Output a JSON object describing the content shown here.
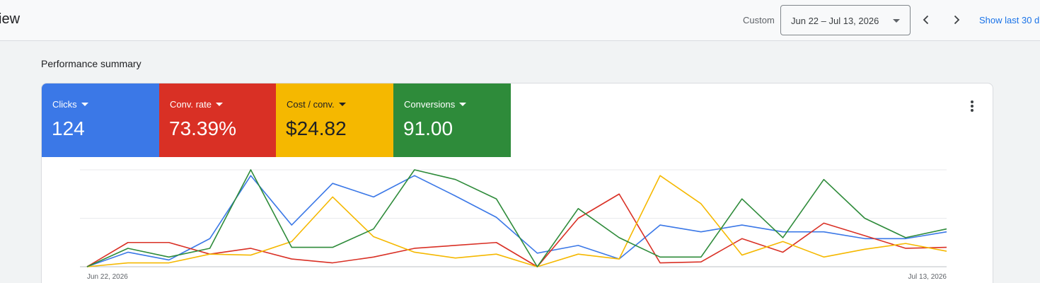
{
  "header": {
    "title": "iew",
    "custom_label": "Custom",
    "date_range": "Jun 22 – Jul 13, 2026",
    "show_last": "Show last 30 d"
  },
  "section": {
    "title": "Performance summary"
  },
  "metrics": [
    {
      "label": "Clicks",
      "value": "124",
      "color": "#3b78e7"
    },
    {
      "label": "Conv. rate",
      "value": "73.39%",
      "color": "#d93025"
    },
    {
      "label": "Cost / conv.",
      "value": "$24.82",
      "color": "#f5b800"
    },
    {
      "label": "Conversions",
      "value": "91.00",
      "color": "#2e8b3a"
    }
  ],
  "chart_data": {
    "type": "line",
    "x": [
      "Jun 22, 2026",
      "Jun 23, 2026",
      "Jun 24, 2026",
      "Jun 25, 2026",
      "Jun 26, 2026",
      "Jun 27, 2026",
      "Jun 28, 2026",
      "Jun 29, 2026",
      "Jun 30, 2026",
      "Jul 1, 2026",
      "Jul 2, 2026",
      "Jul 3, 2026",
      "Jul 4, 2026",
      "Jul 5, 2026",
      "Jul 6, 2026",
      "Jul 7, 2026",
      "Jul 8, 2026",
      "Jul 9, 2026",
      "Jul 10, 2026",
      "Jul 11, 2026",
      "Jul 12, 2026",
      "Jul 13, 2026"
    ],
    "tick_labels": [
      "Jun 22, 2026",
      "Jul 13, 2026"
    ],
    "ylim": [
      0,
      1
    ],
    "grid": true,
    "series": [
      {
        "color": "#3b78e7",
        "values": [
          0,
          0.15,
          0.07,
          0.29,
          0.94,
          0.43,
          0.86,
          0.72,
          0.94,
          0.73,
          0.51,
          0.14,
          0.22,
          0.08,
          0.43,
          0.36,
          0.43,
          0.36,
          0.36,
          0.29,
          0.29,
          0.36
        ]
      },
      {
        "color": "#d93025",
        "values": [
          0,
          0.25,
          0.25,
          0.13,
          0.19,
          0.08,
          0.04,
          0.1,
          0.19,
          0.22,
          0.25,
          0,
          0.5,
          0.75,
          0.04,
          0.05,
          0.29,
          0.15,
          0.45,
          0.32,
          0.19,
          0.2
        ]
      },
      {
        "color": "#f5b800",
        "values": [
          0,
          0.04,
          0.04,
          0.13,
          0.12,
          0.26,
          0.72,
          0.31,
          0.15,
          0.09,
          0.13,
          0,
          0.13,
          0.08,
          0.94,
          0.65,
          0.12,
          0.26,
          0.1,
          0.18,
          0.24,
          0.16
        ]
      },
      {
        "color": "#2e8b3a",
        "values": [
          0,
          0.19,
          0.1,
          0.19,
          1.0,
          0.2,
          0.2,
          0.39,
          1.0,
          0.9,
          0.7,
          0,
          0.6,
          0.3,
          0.1,
          0.1,
          0.7,
          0.3,
          0.9,
          0.5,
          0.3,
          0.39
        ]
      }
    ]
  },
  "colors": {
    "accent": "#1a73e8"
  },
  "icons": {
    "prev": "chevron-left-icon",
    "next": "chevron-right-icon",
    "more": "more-vert-icon",
    "dropdown": "caret-down-icon"
  }
}
